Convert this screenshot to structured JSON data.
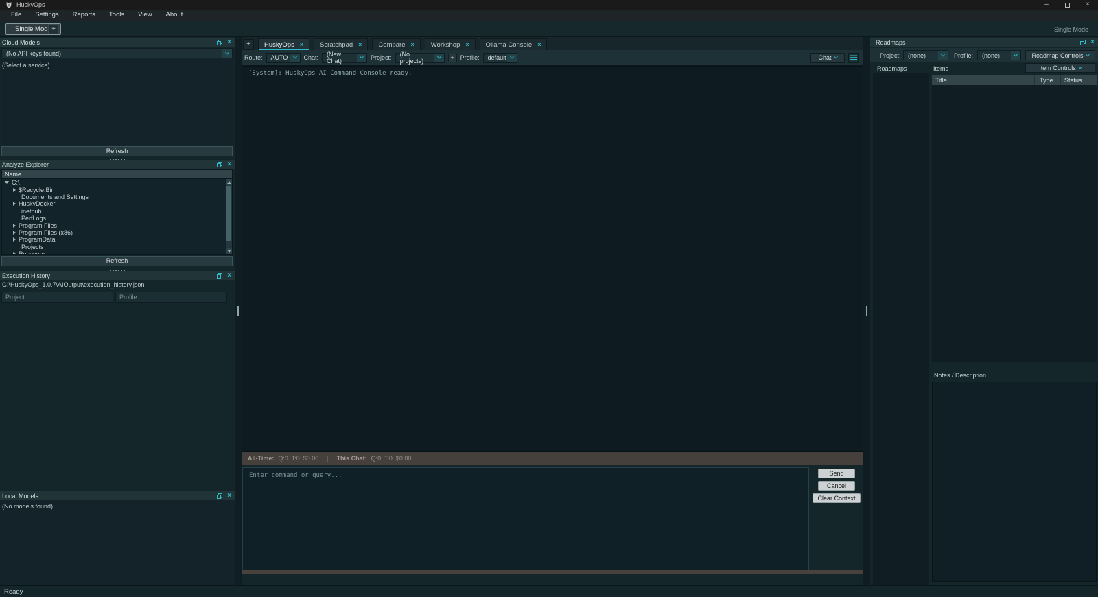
{
  "window": {
    "title": "HuskyOps",
    "status_text": "Ready",
    "mode_indicator": "Single Mode"
  },
  "icons": {
    "close": "×",
    "minimize": "–",
    "add": "+"
  },
  "menu": {
    "items": [
      "File",
      "Settings",
      "Reports",
      "Tools",
      "View",
      "About"
    ]
  },
  "mode_bar": {
    "active_tab": "Single Mode",
    "add_button": "+"
  },
  "left_dock": {
    "cloud_models": {
      "title": "Cloud Models",
      "combo_value": "(No API keys found)",
      "empty_text": "(Select a service)",
      "refresh_label": "Refresh"
    },
    "analyze_explorer": {
      "title": "Analyze Explorer",
      "column_header": "Name",
      "tree": [
        {
          "label": "C:\\",
          "depth": 0,
          "state": "expanded"
        },
        {
          "label": "$Recycle.Bin",
          "depth": 1,
          "state": "collapsed"
        },
        {
          "label": "Documents and Settings",
          "depth": 1,
          "state": "none"
        },
        {
          "label": "HuskyDocker",
          "depth": 1,
          "state": "collapsed"
        },
        {
          "label": "inetpub",
          "depth": 1,
          "state": "none"
        },
        {
          "label": "PerfLogs",
          "depth": 1,
          "state": "none"
        },
        {
          "label": "Program Files",
          "depth": 1,
          "state": "collapsed"
        },
        {
          "label": "Program Files (x86)",
          "depth": 1,
          "state": "collapsed"
        },
        {
          "label": "ProgramData",
          "depth": 1,
          "state": "collapsed"
        },
        {
          "label": "Projects",
          "depth": 1,
          "state": "none"
        },
        {
          "label": "Recovery",
          "depth": 1,
          "state": "collapsed"
        }
      ],
      "refresh_label": "Refresh"
    },
    "execution_history": {
      "title": "Execution History",
      "path": "G:\\HuskyOps_1.0.7\\AIOutput\\execution_history.jsonl",
      "project_placeholder": "Project",
      "profile_placeholder": "Profile"
    },
    "local_models": {
      "title": "Local Models",
      "empty_text": "(No models found)"
    }
  },
  "center": {
    "add_tab_label": "+",
    "tabs": [
      "HuskyOps",
      "Scratchpad",
      "Compare",
      "Workshop",
      "Ollama Console"
    ],
    "active_tab": "HuskyOps",
    "toolbar": {
      "route_label": "Route:",
      "route_value": "AUTO",
      "chat_label": "Chat:",
      "chat_value": "(New Chat)",
      "project_label": "Project:",
      "project_value": "(No projects)",
      "add_project_label": "+",
      "profile_label": "Profile:",
      "profile_value": "default",
      "chat_menu_label": "Chat"
    },
    "console_text": "[System]: HuskyOps AI Command Console ready.",
    "stats": {
      "all_time_label": "All-Time:",
      "all_time_value": "Q:0  T:0  $0.00",
      "separator": "|",
      "this_chat_label": "This Chat:",
      "this_chat_value": "Q:0  T:0  $0.00"
    },
    "input_placeholder": "Enter command or query...",
    "buttons": {
      "send": "Send",
      "cancel": "Cancel",
      "clear_context": "Clear Context"
    }
  },
  "right_dock": {
    "title": "Roadmaps",
    "project_label": "Project:",
    "project_value": "(none)",
    "profile_label": "Profile:",
    "profile_value": "(none)",
    "roadmap_controls_label": "Roadmap Controls",
    "list_label": "Roadmaps",
    "items_label": "Items",
    "item_controls_label": "Item Controls",
    "table_headers": [
      "Title",
      "Type",
      "Status"
    ],
    "notes_label": "Notes / Description"
  },
  "colors": {
    "accent": "#2fbdcb",
    "stats_bar": "#45403b",
    "light_button": "#ccd2d4",
    "panel_header": "#213539"
  }
}
